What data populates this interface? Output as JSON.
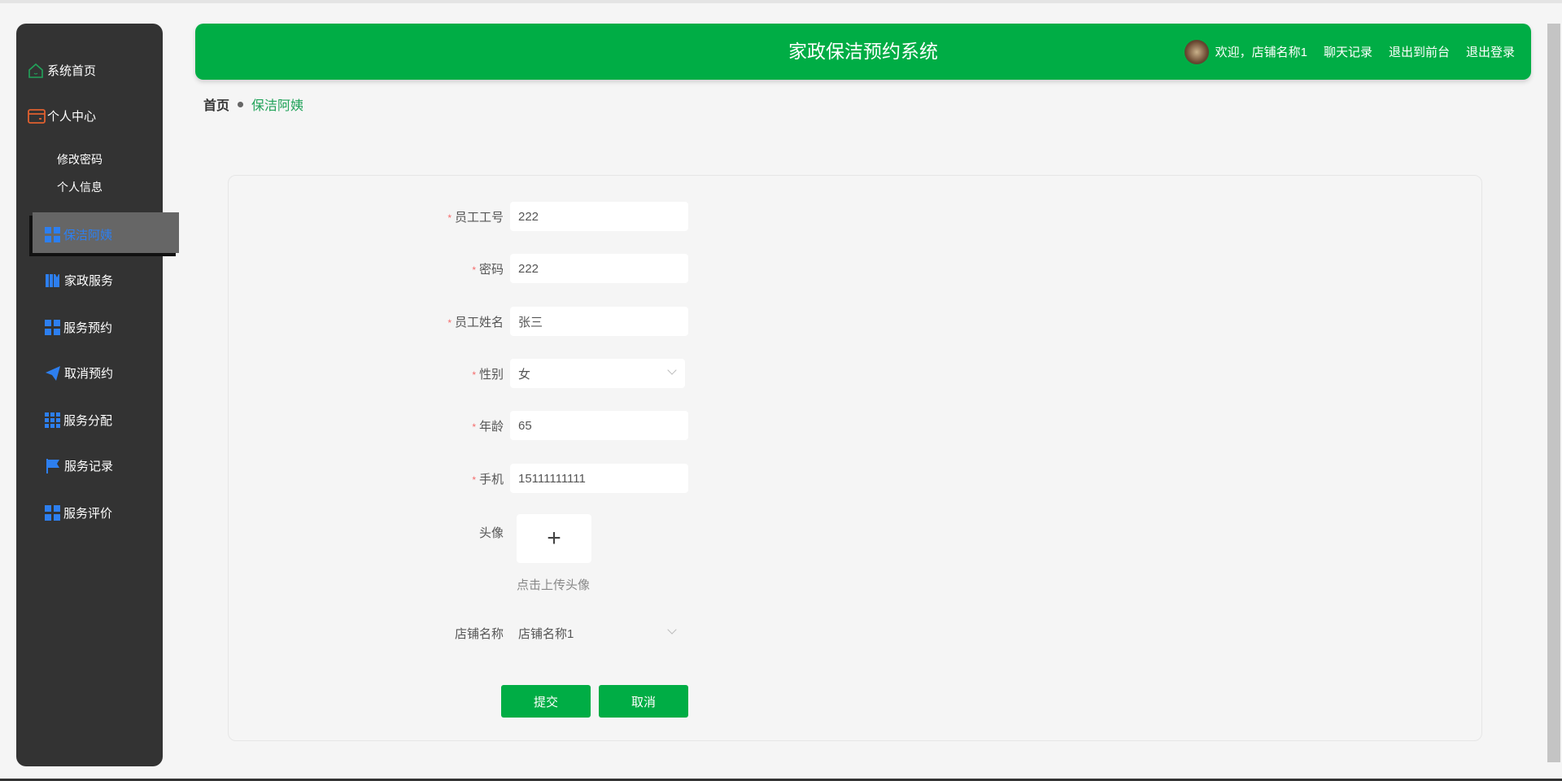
{
  "colors": {
    "brand": "#00ad45",
    "sidebar": "#333333",
    "active_text": "#2d7ff0"
  },
  "sidebar": {
    "items": [
      {
        "label": "系统首页",
        "icon": "home-icon"
      },
      {
        "label": "个人中心",
        "icon": "wallet-icon"
      },
      {
        "label": "保洁阿姨",
        "icon": "grid-icon",
        "active": true
      },
      {
        "label": "家政服务",
        "icon": "books-icon"
      },
      {
        "label": "服务预约",
        "icon": "grid-icon"
      },
      {
        "label": "取消预约",
        "icon": "send-icon"
      },
      {
        "label": "服务分配",
        "icon": "apps-icon"
      },
      {
        "label": "服务记录",
        "icon": "flag-icon"
      },
      {
        "label": "服务评价",
        "icon": "grid-icon"
      }
    ],
    "sub_items": [
      "修改密码",
      "个人信息"
    ]
  },
  "header": {
    "title": "家政保洁预约系统",
    "welcome": "欢迎，店铺名称1",
    "links": [
      "聊天记录",
      "退出到前台",
      "退出登录"
    ]
  },
  "breadcrumb": {
    "home": "首页",
    "current": "保洁阿姨"
  },
  "form": {
    "fields": [
      {
        "label": "员工工号",
        "value": "222",
        "required": true
      },
      {
        "label": "密码",
        "value": "222",
        "required": true
      },
      {
        "label": "员工姓名",
        "value": "张三",
        "required": true
      },
      {
        "label": "性别",
        "value": "女",
        "required": true,
        "type": "select"
      },
      {
        "label": "年龄",
        "value": "65",
        "required": true
      },
      {
        "label": "手机",
        "value": "15111111111",
        "required": true
      }
    ],
    "avatar_label": "头像",
    "upload_plus": "+",
    "upload_hint": "点击上传头像",
    "shop_label": "店铺名称",
    "shop_value": "店铺名称1",
    "required_mark": "*",
    "submit": "提交",
    "cancel": "取消"
  }
}
